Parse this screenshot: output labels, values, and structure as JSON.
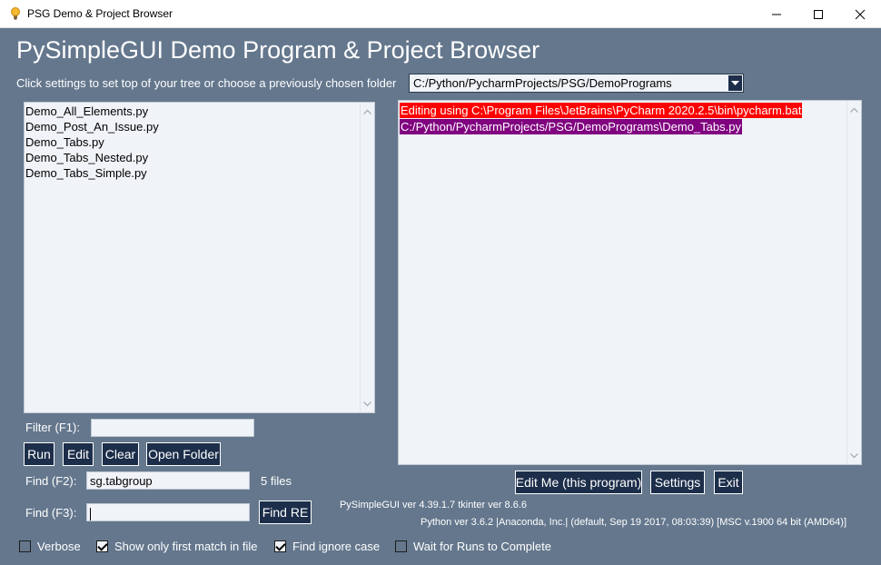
{
  "window": {
    "title": "PSG Demo & Project Browser",
    "minimize_glyph": "—",
    "maximize_glyph": "☐",
    "close_glyph": "✕"
  },
  "header": {
    "title": "PySimpleGUI Demo Program & Project Browser",
    "hint": "Click settings to set top of your tree or choose a previously chosen folder"
  },
  "folder_combo": {
    "value": "C:/Python/PycharmProjects/PSG/DemoPrograms"
  },
  "file_list": {
    "items": [
      "Demo_All_Elements.py",
      "Demo_Post_An_Issue.py",
      "Demo_Tabs.py",
      "Demo_Tabs_Nested.py",
      "Demo_Tabs_Simple.py"
    ]
  },
  "output": {
    "lines": [
      {
        "text": "Editing using C:\\Program Files\\JetBrains\\PyCharm 2020.2.5\\bin\\pycharm.bat",
        "bg": "#ff0000"
      },
      {
        "text": "C:/Python/PycharmProjects/PSG/DemoPrograms\\Demo_Tabs.py",
        "bg": "#800080"
      }
    ]
  },
  "filter": {
    "label": "Filter (F1):",
    "value": ""
  },
  "buttons": {
    "run": "Run",
    "edit": "Edit",
    "clear": "Clear",
    "open_folder": "Open Folder",
    "find_re": "Find RE",
    "edit_me": "Edit Me (this program)",
    "settings": "Settings",
    "exit": "Exit"
  },
  "find": {
    "label": "Find (F2):",
    "value": "sg.tabgroup",
    "count": "5 files"
  },
  "find_re": {
    "label": "Find (F3):",
    "value": ""
  },
  "options": [
    {
      "label": "Verbose",
      "checked": false
    },
    {
      "label": "Show only first match in file",
      "checked": true
    },
    {
      "label": "Find ignore case",
      "checked": true
    },
    {
      "label": "Wait for Runs to Complete",
      "checked": false
    }
  ],
  "version_info": {
    "psg": "PySimpleGUI ver 4.39.1.7  tkinter ver 8.6.6",
    "python": "Python ver 3.6.2 |Anaconda, Inc.| (default, Sep 19 2017, 08:03:39) [MSC v.1900 64 bit (AMD64)]"
  },
  "colors": {
    "window_bg": "#64778d",
    "button_bg": "#1c2e4a",
    "input_bg": "#f0f3f7"
  }
}
